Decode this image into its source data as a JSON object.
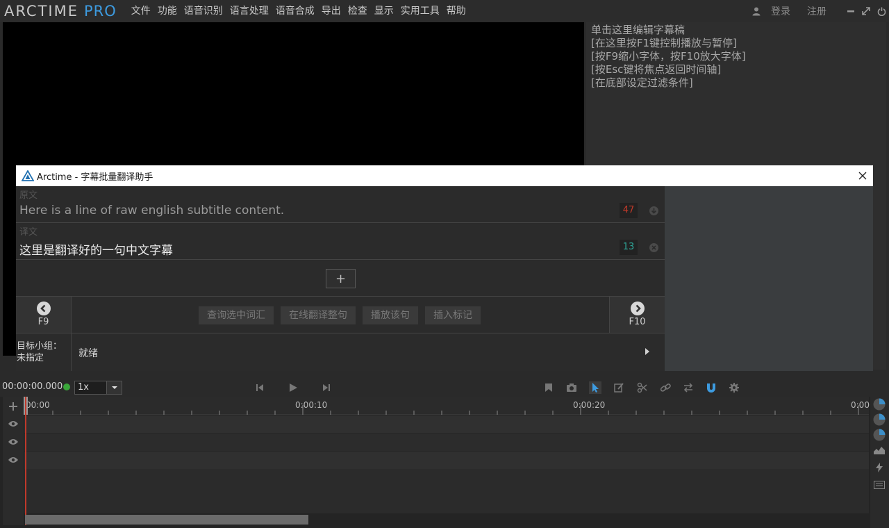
{
  "app": {
    "logo_main": "ARCTIME",
    "logo_pro": "PRO"
  },
  "menu": [
    "文件",
    "功能",
    "语音识别",
    "语言处理",
    "语音合成",
    "导出",
    "检查",
    "显示",
    "实用工具",
    "帮助"
  ],
  "account": {
    "login": "登录",
    "register": "注册"
  },
  "subtitle_hints": [
    "单击这里编辑字幕稿",
    "[在这里按F1键控制播放与暂停]",
    "[按F9缩小字体，按F10放大字体]",
    "[按Esc键将焦点返回时间轴]",
    "[在底部设定过滤条件]"
  ],
  "dialog": {
    "title": "Arctime - 字幕批量翻译助手",
    "source": {
      "label": "原文",
      "text": "Here is a line of raw english subtitle content.",
      "count": "47",
      "count_color": "#c43a2a"
    },
    "translation": {
      "label": "译文",
      "text": "这里是翻译好的一句中文字幕",
      "count": "13",
      "count_color": "#2fa89a"
    },
    "add_label": "+",
    "prev_key": "F9",
    "next_key": "F10",
    "actions": [
      "查询选中词汇",
      "在线翻译整句",
      "播放该句",
      "插入标记"
    ],
    "group_label": "目标小组：",
    "group_value": "未指定",
    "status": "就绪"
  },
  "transport": {
    "timecode": "00:00:00.000",
    "speed": "1x",
    "status_dot_color": "#3aa63a"
  },
  "timeline": {
    "ruler_labels": [
      "00:00",
      "0:00:10",
      "0:00:20",
      "0:00:"
    ],
    "track_count": 3
  },
  "colors": {
    "accent": "#3d9be0",
    "playhead": "#c0392b"
  }
}
